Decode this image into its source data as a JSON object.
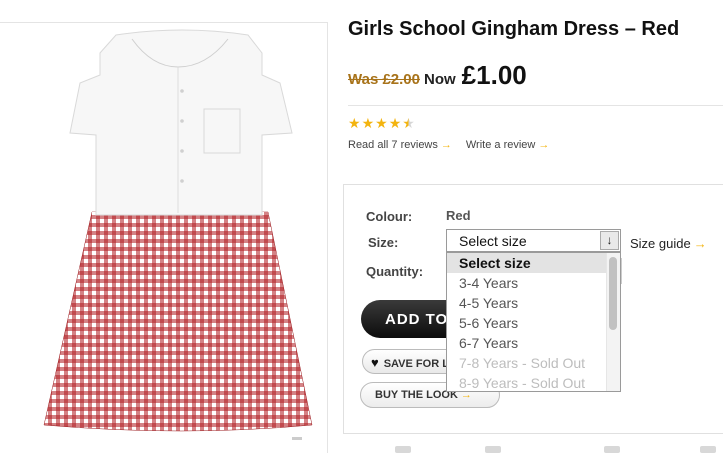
{
  "product": {
    "title": "Girls School Gingham Dress – Red",
    "was_price": "Was £2.00",
    "now_label": "Now",
    "now_price": "£1.00",
    "rating": 4.5,
    "read_reviews": "Read all 7 reviews",
    "write_review": "Write a review"
  },
  "options": {
    "colour_label": "Colour:",
    "colour_value": "Red",
    "size_label": "Size:",
    "size_selected": "Select size",
    "size_guide": "Size guide",
    "quantity_label": "Quantity:"
  },
  "dropdown": {
    "items": [
      {
        "label": "Select size",
        "state": "selected"
      },
      {
        "label": "3-4 Years",
        "state": "available"
      },
      {
        "label": "4-5 Years",
        "state": "available"
      },
      {
        "label": "5-6 Years",
        "state": "available"
      },
      {
        "label": "6-7 Years",
        "state": "available"
      },
      {
        "label": "7-8 Years - Sold Out",
        "state": "disabled"
      },
      {
        "label": "8-9 Years - Sold Out",
        "state": "disabled"
      }
    ]
  },
  "buttons": {
    "add_to_bag": "ADD TO BAG",
    "save_for_later": "SAVE FOR LATER",
    "buy_the_look": "BUY THE LOOK"
  },
  "icons": {
    "arrow": "→",
    "select_arrow": "↓",
    "heart": "♥",
    "star": "★"
  },
  "colors": {
    "accent": "#f3b40f",
    "was_price": "#a8731a",
    "gingham_red": "#b01c20"
  }
}
